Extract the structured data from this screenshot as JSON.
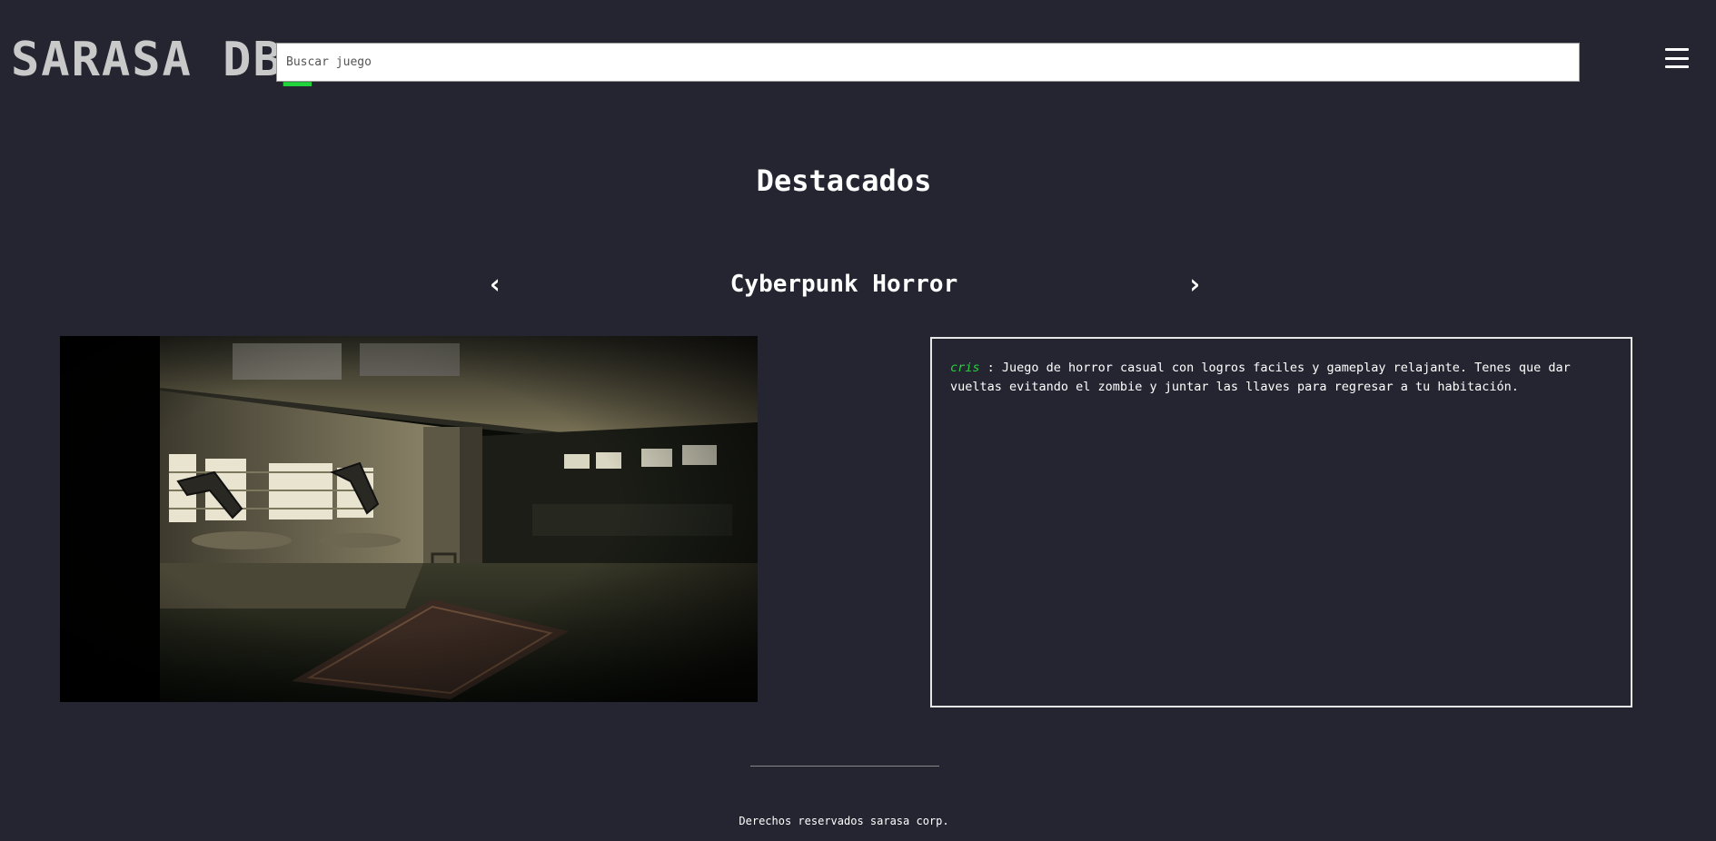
{
  "header": {
    "logo_text": "SARASA DB",
    "logo_cursor": "_",
    "search_placeholder": "Buscar juego",
    "menu_icon": "hamburger-menu-icon"
  },
  "featured": {
    "title": "Destacados",
    "prev_arrow": "‹",
    "next_arrow": "›",
    "game_title": "Cyberpunk Horror",
    "screenshot_alt": "Cyberpunk Horror screenshot",
    "review": {
      "author": "cris",
      "separator": " : ",
      "text": "Juego de horror casual con logros faciles y gameplay relajante. Tenes que dar vueltas evitando el zombie y juntar las llaves para regresar a tu habitación."
    }
  },
  "footer": {
    "copyright": "Derechos reservados sarasa corp."
  },
  "colors": {
    "background": "#252532",
    "accent_green": "#22d43b",
    "logo_gray": "#c9c9c9"
  }
}
